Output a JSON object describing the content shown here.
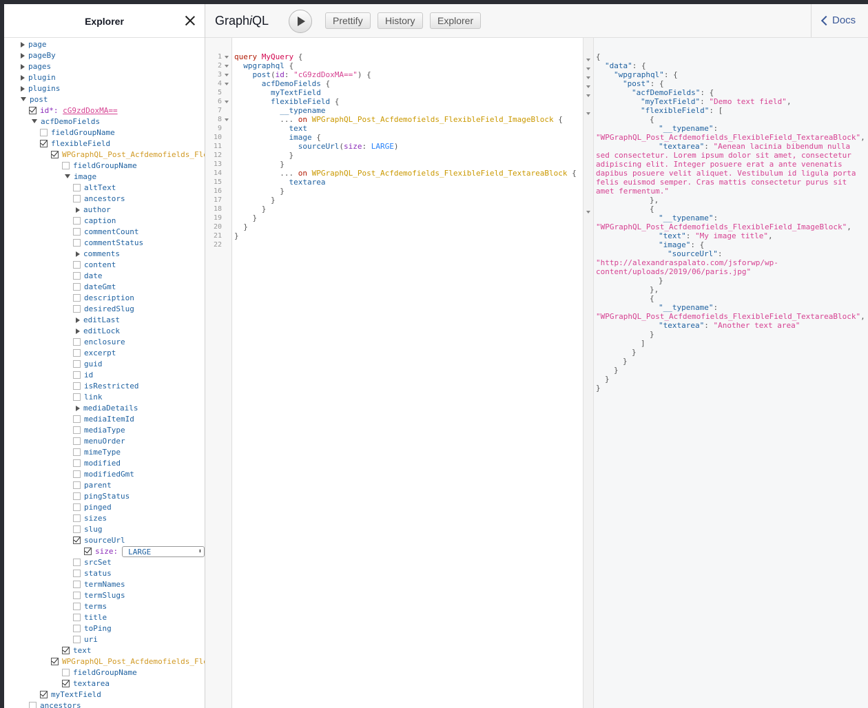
{
  "explorer": {
    "title": "Explorer",
    "items": [
      {
        "label": "page",
        "kind": "arrow-right"
      },
      {
        "label": "pageBy",
        "kind": "arrow-right"
      },
      {
        "label": "pages",
        "kind": "arrow-right"
      },
      {
        "label": "plugin",
        "kind": "arrow-right"
      },
      {
        "label": "plugins",
        "kind": "arrow-right"
      },
      {
        "label": "post",
        "kind": "arrow-down"
      },
      {
        "label": "id*:",
        "arg_value": "cG9zdDoxMA=="
      },
      {
        "label": "acfDemoFields",
        "kind": "arrow-down"
      },
      {
        "label": "fieldGroupName"
      },
      {
        "label": "flexibleField"
      },
      {
        "label": "WPGraphQL_Post_Acfdemofields_Flexib"
      },
      {
        "label": "fieldGroupName"
      },
      {
        "label": "image"
      },
      {
        "label": "altText"
      },
      {
        "label": "ancestors"
      },
      {
        "label": "author"
      },
      {
        "label": "caption"
      },
      {
        "label": "commentCount"
      },
      {
        "label": "commentStatus"
      },
      {
        "label": "comments"
      },
      {
        "label": "content"
      },
      {
        "label": "date"
      },
      {
        "label": "dateGmt"
      },
      {
        "label": "description"
      },
      {
        "label": "desiredSlug"
      },
      {
        "label": "editLast"
      },
      {
        "label": "editLock"
      },
      {
        "label": "enclosure"
      },
      {
        "label": "excerpt"
      },
      {
        "label": "guid"
      },
      {
        "label": "id"
      },
      {
        "label": "isRestricted"
      },
      {
        "label": "link"
      },
      {
        "label": "mediaDetails"
      },
      {
        "label": "mediaItemId"
      },
      {
        "label": "mediaType"
      },
      {
        "label": "menuOrder"
      },
      {
        "label": "mimeType"
      },
      {
        "label": "modified"
      },
      {
        "label": "modifiedGmt"
      },
      {
        "label": "parent"
      },
      {
        "label": "pingStatus"
      },
      {
        "label": "pinged"
      },
      {
        "label": "sizes"
      },
      {
        "label": "slug"
      },
      {
        "label": "sourceUrl"
      },
      {
        "label": "size:",
        "select_value": "LARGE"
      },
      {
        "label": "srcSet"
      },
      {
        "label": "status"
      },
      {
        "label": "termNames"
      },
      {
        "label": "termSlugs"
      },
      {
        "label": "terms"
      },
      {
        "label": "title"
      },
      {
        "label": "toPing"
      },
      {
        "label": "uri"
      },
      {
        "label": "text"
      },
      {
        "label": "WPGraphQL_Post_Acfdemofields_Flexib"
      },
      {
        "label": "fieldGroupName"
      },
      {
        "label": "textarea"
      },
      {
        "label": "myTextField"
      },
      {
        "label": "ancestors"
      }
    ]
  },
  "toolbar": {
    "logo_prefix": "Graph",
    "logo_italic": "i",
    "logo_suffix": "QL",
    "prettify": "Prettify",
    "history": "History",
    "explorer": "Explorer",
    "docs": "Docs"
  },
  "query": {
    "line_numbers": [
      "1",
      "2",
      "3",
      "4",
      "5",
      "6",
      "7",
      "8",
      "9",
      "10",
      "11",
      "12",
      "13",
      "14",
      "15",
      "16",
      "17",
      "18",
      "19",
      "20",
      "21",
      "22"
    ],
    "tokens": {
      "l1_kw": "query",
      "l1_name": "MyQuery",
      "l1_brace": " {",
      "l2_f": "wpgraphql",
      "l2_b": " {",
      "l3_f": "post",
      "l3_p": "(",
      "l3_a": "id",
      "l3_c": ": ",
      "l3_s": "\"cG9zdDoxMA==\"",
      "l3_e": ") {",
      "l4_f": "acfDemoFields",
      "l4_b": " {",
      "l5_f": "myTextField",
      "l6_f": "flexibleField",
      "l6_b": " {",
      "l7_f": "__typename",
      "l8_d": "... ",
      "l8_on": "on",
      "l8_t": "WPGraphQL_Post_Acfdemofields_FlexibleField_ImageBlock",
      "l8_b": " {",
      "l9_f": "text",
      "l10_f": "image",
      "l10_b": " {",
      "l11_f": "sourceUrl",
      "l11_p": "(",
      "l11_a": "size",
      "l11_c": ": ",
      "l11_v": "LARGE",
      "l11_e": ")",
      "l12": "}",
      "l13": "}",
      "l14_d": "... ",
      "l14_on": "on",
      "l14_t": "WPGraphQL_Post_Acfdemofields_FlexibleField_TextareaBlock",
      "l14_b": " {",
      "l15_f": "textarea",
      "l16": "}",
      "l17": "}",
      "l18": "}",
      "l19": "}",
      "l20": "}",
      "l21": "}"
    }
  },
  "result": {
    "lines": [
      {
        "t": "{"
      },
      {
        "k": "\"data\"",
        "r": ": {"
      },
      {
        "k": "\"wpgraphql\"",
        "r": ": {"
      },
      {
        "k": "\"post\"",
        "r": ": {"
      },
      {
        "k": "\"acfDemoFields\"",
        "r": ": {"
      },
      {
        "k": "\"myTextField\"",
        "r": ": ",
        "s": "\"Demo text field\"",
        "e": ","
      },
      {
        "k": "\"flexibleField\"",
        "r": ": ["
      },
      {
        "t": "{"
      },
      {
        "k": "\"__typename\"",
        "r": ":"
      },
      {
        "s": "\"WPGraphQL_Post_Acfdemofields_FlexibleField_TextareaBlock\"",
        "e": ","
      },
      {
        "k": "\"textarea\"",
        "r": ": ",
        "s": "\"Aenean lacinia bibendum nulla"
      },
      {
        "s": "sed consectetur. Lorem ipsum dolor sit amet, consectetur"
      },
      {
        "s": "adipiscing elit. Integer posuere erat a ante venenatis"
      },
      {
        "s": "dapibus posuere velit aliquet. Vestibulum id ligula porta"
      },
      {
        "s": "felis euismod semper. Cras mattis consectetur purus sit"
      },
      {
        "s": "amet fermentum.\""
      },
      {
        "t": "},"
      },
      {
        "t": "{"
      },
      {
        "k": "\"__typename\"",
        "r": ":"
      },
      {
        "s": "\"WPGraphQL_Post_Acfdemofields_FlexibleField_ImageBlock\"",
        "e": ","
      },
      {
        "k": "\"text\"",
        "r": ": ",
        "s": "\"My image title\"",
        "e": ","
      },
      {
        "k": "\"image\"",
        "r": ": {"
      },
      {
        "k": "\"sourceUrl\"",
        "r": ":"
      },
      {
        "s": "\"http://alexandraspalato.com/jsforwp/wp-"
      },
      {
        "s": "content/uploads/2019/06/paris.jpg\""
      },
      {
        "t": "}"
      },
      {
        "t": "},"
      },
      {
        "t": "{"
      },
      {
        "k": "\"__typename\"",
        "r": ":"
      },
      {
        "s": "\"WPGraphQL_Post_Acfdemofields_FlexibleField_TextareaBlock\"",
        "e": ","
      },
      {
        "k": "\"textarea\"",
        "r": ": ",
        "s": "\"Another text area\""
      },
      {
        "t": "}"
      },
      {
        "t": "]"
      },
      {
        "t": "}"
      },
      {
        "t": "}"
      },
      {
        "t": "}"
      },
      {
        "t": "}"
      },
      {
        "t": "}"
      }
    ]
  }
}
